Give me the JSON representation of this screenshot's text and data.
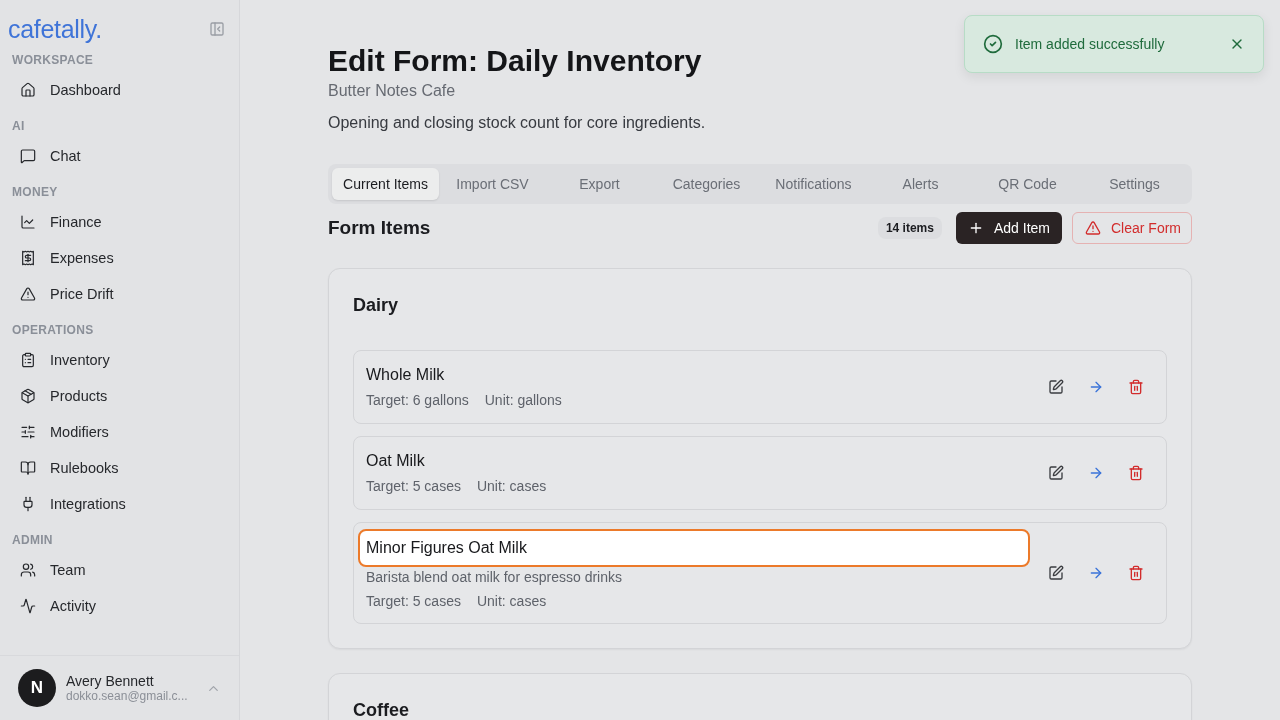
{
  "sidebar": {
    "logo": "cafetally.",
    "sections": [
      {
        "label": "WORKSPACE",
        "items": [
          {
            "label": "Dashboard"
          }
        ]
      },
      {
        "label": "AI",
        "items": [
          {
            "label": "Chat"
          }
        ]
      },
      {
        "label": "MONEY",
        "items": [
          {
            "label": "Finance"
          },
          {
            "label": "Expenses"
          },
          {
            "label": "Price Drift"
          }
        ]
      },
      {
        "label": "OPERATIONS",
        "items": [
          {
            "label": "Inventory"
          },
          {
            "label": "Products"
          },
          {
            "label": "Modifiers"
          },
          {
            "label": "Rulebooks"
          },
          {
            "label": "Integrations"
          }
        ]
      },
      {
        "label": "ADMIN",
        "items": [
          {
            "label": "Team"
          },
          {
            "label": "Activity"
          }
        ]
      }
    ],
    "user": {
      "initial": "N",
      "name": "Avery Bennett",
      "email": "dokko.sean@gmail.c..."
    }
  },
  "header": {
    "title": "Edit Form: Daily Inventory",
    "subtitle": "Butter Notes Cafe",
    "description": "Opening and closing stock count for core ingredients."
  },
  "tabs": [
    {
      "label": "Current Items",
      "selected": true
    },
    {
      "label": "Import CSV",
      "selected": false
    },
    {
      "label": "Export",
      "selected": false
    },
    {
      "label": "Categories",
      "selected": false
    },
    {
      "label": "Notifications",
      "selected": false
    },
    {
      "label": "Alerts",
      "selected": false
    },
    {
      "label": "QR Code",
      "selected": false
    },
    {
      "label": "Settings",
      "selected": false
    }
  ],
  "form_items": {
    "title": "Form Items",
    "count": "14 items",
    "add_button": "Add Item",
    "clear_button": "Clear Form"
  },
  "categories": [
    {
      "name": "Dairy",
      "items": [
        {
          "kind": "normal",
          "name": "Whole Milk",
          "target": "Target: 6 gallons",
          "unit": "Unit: gallons"
        },
        {
          "kind": "normal",
          "name": "Oat Milk",
          "target": "Target: 5 cases",
          "unit": "Unit: cases"
        },
        {
          "kind": "editing",
          "name": "Minor Figures Oat Milk",
          "description": "Barista blend oat milk for espresso drinks",
          "target": "Target: 5 cases",
          "unit": "Unit: cases"
        }
      ]
    },
    {
      "name": "Coffee"
    }
  ],
  "toast": {
    "message": "Item added successfully"
  }
}
